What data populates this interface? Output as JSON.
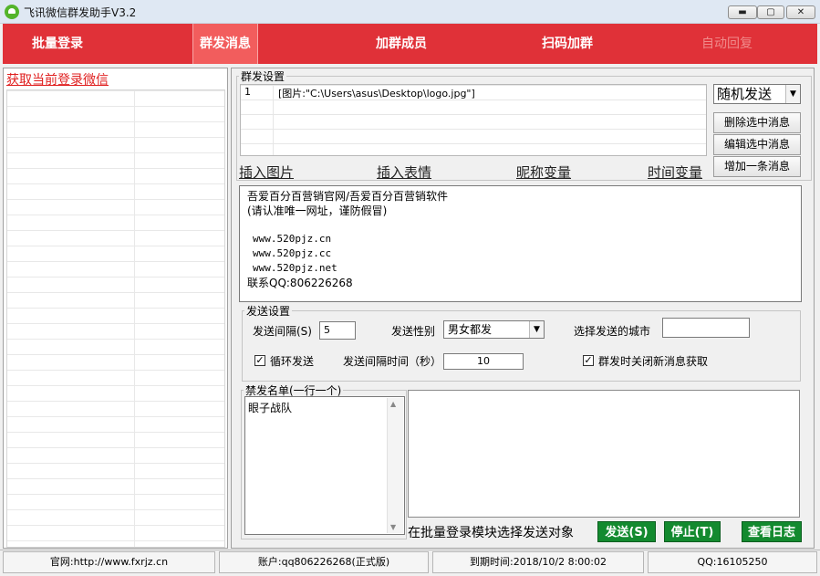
{
  "window": {
    "title": "飞讯微信群发助手V3.2",
    "minimize_glyph": "▬",
    "maximize_glyph": "▢",
    "close_glyph": "✕"
  },
  "tabs": [
    {
      "label": "批量登录"
    },
    {
      "label": "群发消息"
    },
    {
      "label": "加群成员"
    },
    {
      "label": "扫码加群"
    },
    {
      "label": "自动回复"
    }
  ],
  "left_panel": {
    "get_wechat_link": "获取当前登录微信"
  },
  "group_send": {
    "legend": "群发设置",
    "message_list": [
      {
        "index": "1",
        "text": "[图片:\"C:\\Users\\asus\\Desktop\\logo.jpg\"]"
      }
    ],
    "send_mode": "随机发送",
    "delete_selected": "删除选中消息",
    "edit_selected": "编辑选中消息",
    "add_message": "增加一条消息",
    "insert_image": "插入图片",
    "insert_emoji": "插入表情",
    "nickname_var": "昵称变量",
    "time_var": "时间变量",
    "editor_lines": [
      "吾爱百分百营销官网/吾爱百分百营销软件",
      "(请认准唯一网址，谨防假冒)",
      "www.520pjz.cn",
      "www.520pjz.cc",
      "www.520pjz.net",
      "联系QQ:806226268"
    ]
  },
  "send_settings": {
    "legend": "发送设置",
    "interval_label": "发送间隔(S)",
    "interval_value": "5",
    "gender_label": "发送性别",
    "gender_value": "男女都发",
    "city_label": "选择发送的城市",
    "city_value": "",
    "loop_send_label": "循环发送",
    "loop_send_checked": true,
    "interval_time_label": "发送间隔时间（秒）",
    "interval_time_value": "10",
    "close_msg_label": "群发时关闭新消息获取",
    "close_msg_checked": true
  },
  "blacklist": {
    "legend": "禁发名单(一行一个)",
    "content": "眼子战队"
  },
  "footer": {
    "hint": "在批量登录模块选择发送对象",
    "send_button": "发送(S)",
    "stop_button": "停止(T)",
    "view_log_button": "查看日志"
  },
  "status_bar": {
    "website": "官网:http://www.fxrjz.cn",
    "account": "账户:qq806226268(正式版)",
    "expire": "到期时间:2018/10/2 8:00:02",
    "qq": "QQ:16105250"
  },
  "colors": {
    "tab_bar": "#e03138",
    "active_tab": "#f25d5d",
    "link_red": "#e02020",
    "action_green": "#138a2f"
  }
}
